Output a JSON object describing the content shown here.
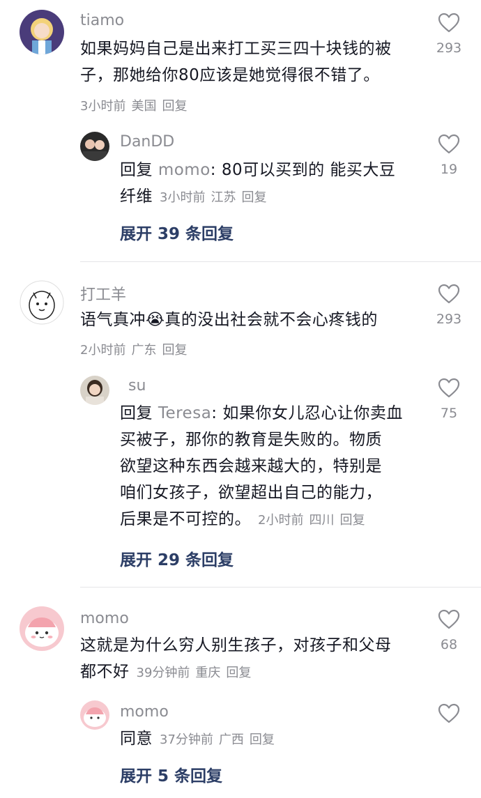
{
  "comments": [
    {
      "username": "tiamo",
      "text_lines": [
        "如果妈妈自己是出来打工买三四十块钱的被",
        "子，那她给你80应该是她觉得很不错了。"
      ],
      "time": "3小时前",
      "location": "美国",
      "reply_label": "回复",
      "likes": "293",
      "replies": [
        {
          "username": "DanDD",
          "reply_prefix": "回复",
          "reply_target": "momo",
          "text_line1": ": 80可以买到的 能买大豆",
          "text_line2": "纤维",
          "time": "3小时前",
          "location": "江苏",
          "reply_label": "回复",
          "likes": "19"
        }
      ],
      "expand_label": "展开 39 条回复"
    },
    {
      "username": "打工羊",
      "text_before_emoji": "语气真冲",
      "emoji": "😭",
      "text_after_emoji": "真的没出社会就不会心疼钱的",
      "time": "2小时前",
      "location": "广东",
      "reply_label": "回复",
      "likes": "293",
      "replies": [
        {
          "username": "su",
          "reply_prefix": "回复",
          "reply_target": "Teresa",
          "text_line1": ": 如果你女儿忍心让你卖血",
          "text_lines_rest": [
            "买被子，那你的教育是失败的。物质",
            "欲望这种东西会越来越大的，特别是",
            "咱们女孩子，欲望超出自己的能力，"
          ],
          "text_last": "后果是不可控的。",
          "time": "2小时前",
          "location": "四川",
          "reply_label": "回复",
          "likes": "75"
        }
      ],
      "expand_label": "展开 29 条回复"
    },
    {
      "username": "momo",
      "text_line1": "这就是为什么穷人别生孩子，对孩子和父母",
      "text_line2": "都不好",
      "time": "39分钟前",
      "location": "重庆",
      "reply_label": "回复",
      "likes": "68",
      "replies": [
        {
          "username": "momo",
          "text": "同意",
          "time": "37分钟前",
          "location": "广西",
          "reply_label": "回复",
          "likes": ""
        }
      ],
      "expand_label": "展开 5 条回复"
    }
  ],
  "colors": {
    "text": "#161823",
    "muted": "#8a8b91",
    "expand": "#2c3e66",
    "divider": "#e5e5e7"
  }
}
